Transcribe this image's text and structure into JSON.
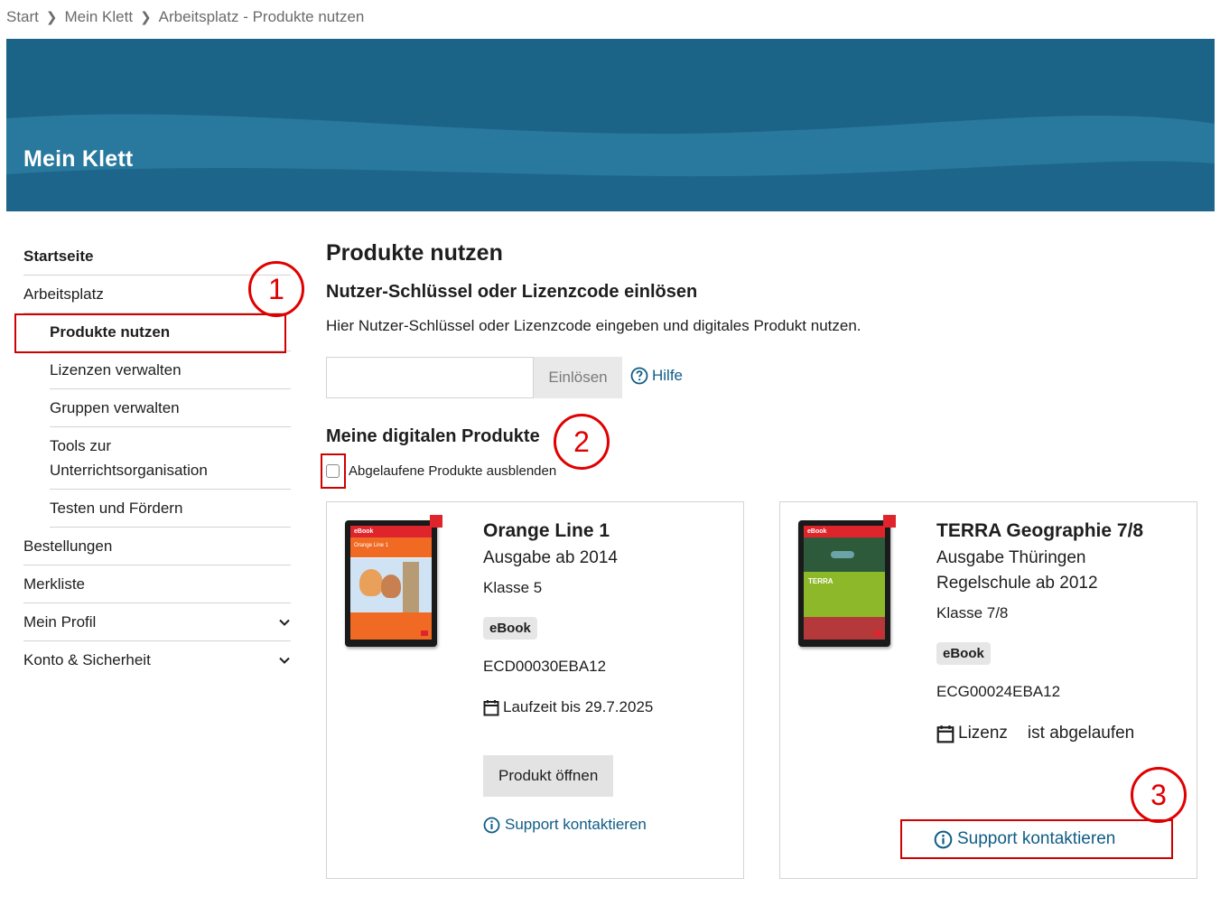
{
  "breadcrumb": {
    "items": [
      "Start",
      "Mein Klett",
      "Arbeitsplatz - Produkte nutzen"
    ]
  },
  "banner": {
    "title": "Mein Klett"
  },
  "sidebar": {
    "items": [
      {
        "label": "Startseite"
      },
      {
        "label": "Arbeitsplatz"
      },
      {
        "label": "Produkte nutzen"
      },
      {
        "label": "Lizenzen verwalten"
      },
      {
        "label": "Gruppen verwalten"
      },
      {
        "label_line1": "Tools zur",
        "label_line2": "Unterrichtsorganisation"
      },
      {
        "label": "Testen und Fördern"
      },
      {
        "label": "Bestellungen"
      },
      {
        "label": "Merkliste"
      },
      {
        "label": "Mein Profil"
      },
      {
        "label": "Konto & Sicherheit"
      }
    ]
  },
  "main": {
    "title": "Produkte nutzen",
    "redeem_heading": "Nutzer-Schlüssel oder Lizenzcode einlösen",
    "redeem_description": "Hier Nutzer-Schlüssel oder Lizenzcode eingeben und digitales Produkt nutzen.",
    "code_input_value": "",
    "redeem_button": "Einlösen",
    "help_link": "Hilfe",
    "products_heading": "Meine digitalen Produkte",
    "hide_expired_label": "Abgelaufene Produkte ausblenden"
  },
  "products": [
    {
      "title": "Orange Line 1",
      "subtitle_lines": [
        "Ausgabe ab 2014"
      ],
      "klasse": "Klasse 5",
      "badge": "eBook",
      "code": "ECD00030EBA12",
      "runtime": "Laufzeit bis 29.7.2025",
      "open_button": "Produkt öffnen",
      "support_link": "Support kontaktieren",
      "cover_tag": "eBook",
      "cover_series": "Orange Line 1"
    },
    {
      "title": "TERRA Geographie 7/8",
      "subtitle_lines": [
        "Ausgabe Thüringen",
        "Regelschule ab 2012"
      ],
      "klasse": "Klasse 7/8",
      "badge": "eBook",
      "code": "ECG00024EBA12",
      "license_word": "Lizenz",
      "license_status": "ist abgelaufen",
      "support_link": "Support kontaktieren",
      "cover_tag": "eBook",
      "cover_series": "TERRA"
    }
  ],
  "annotations": [
    "1",
    "2",
    "3"
  ],
  "colors": {
    "banner": "#1c6388",
    "link": "#0f5d86",
    "annotation": "#e00000"
  }
}
